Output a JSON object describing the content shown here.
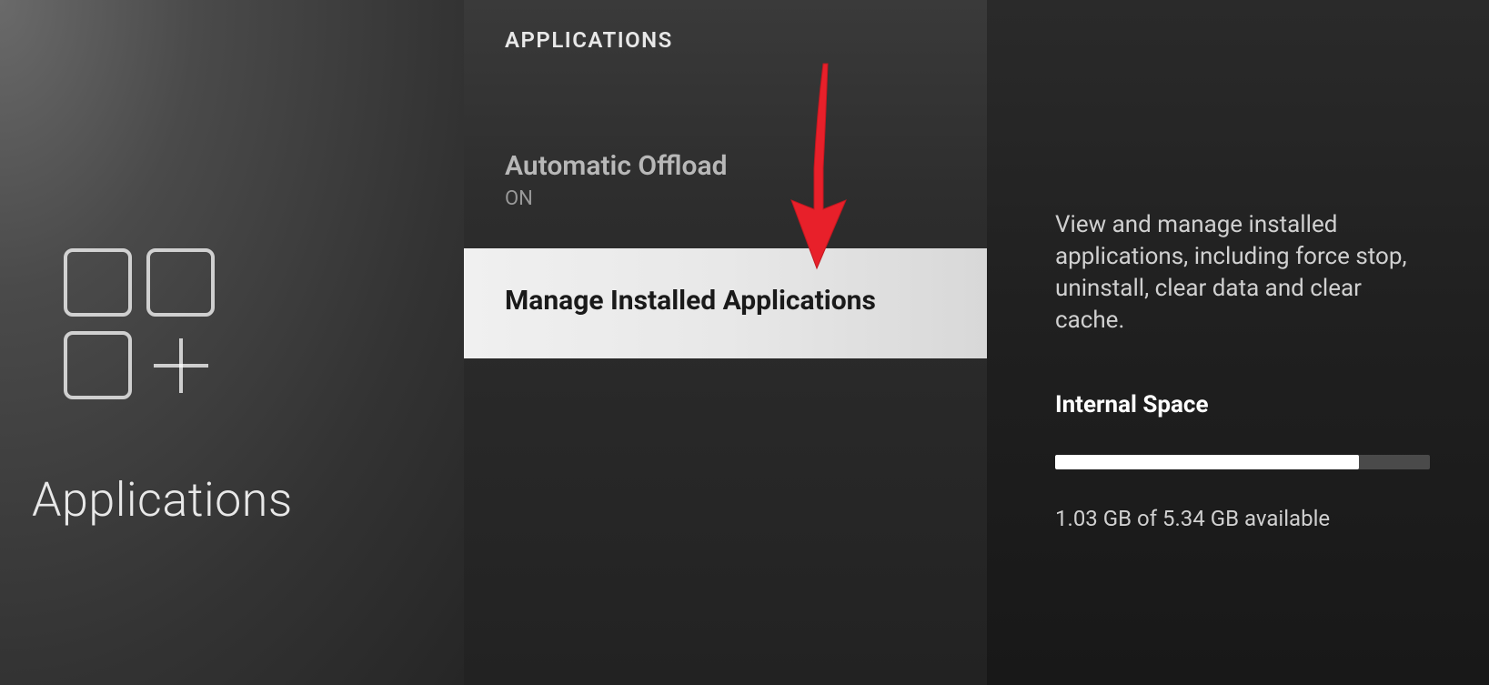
{
  "left_panel": {
    "title": "Applications"
  },
  "middle_panel": {
    "header": "APPLICATIONS",
    "items": [
      {
        "title": "Automatic Offload",
        "subtitle": "ON",
        "selected": false
      },
      {
        "title": "Manage Installed Applications",
        "subtitle": "",
        "selected": true
      }
    ]
  },
  "right_panel": {
    "description": "View and manage installed applications, including force stop, uninstall, clear data and clear cache.",
    "storage_heading": "Internal Space",
    "storage_percent": 81,
    "storage_text": "1.03 GB of 5.34 GB available"
  }
}
